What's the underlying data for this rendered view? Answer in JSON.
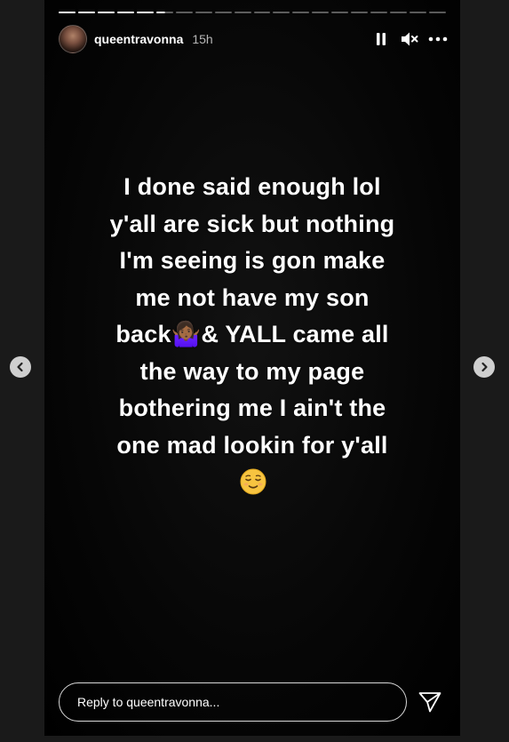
{
  "story": {
    "username": "queentravonna",
    "time": "15h",
    "progress": {
      "segments": 20,
      "completed": 5,
      "active_index": 5,
      "active_fraction": 0.5
    },
    "caption": "I done said enough lol\ny'all are sick but nothing\nI'm seeing is gon make\nme not have my son\nback🤷🏾‍♀️& YALL came all\nthe way to my page\nbothering me I ain't the\none mad lookin for y'all",
    "emoji_icon": "relieved-face-icon",
    "reply_placeholder": "Reply to queentravonna..."
  },
  "controls": {
    "pause_icon": "pause-icon",
    "mute_icon": "muted-speaker-icon",
    "more_icon": "more-options-icon",
    "send_icon": "send-paper-plane-icon"
  },
  "navigation": {
    "prev_icon": "chevron-left-icon",
    "next_icon": "chevron-right-icon"
  },
  "colors": {
    "page_bg": "#1a1a1a",
    "story_bg": "#000000",
    "text": "#ffffff",
    "nav_button": "#cfcfcf"
  }
}
